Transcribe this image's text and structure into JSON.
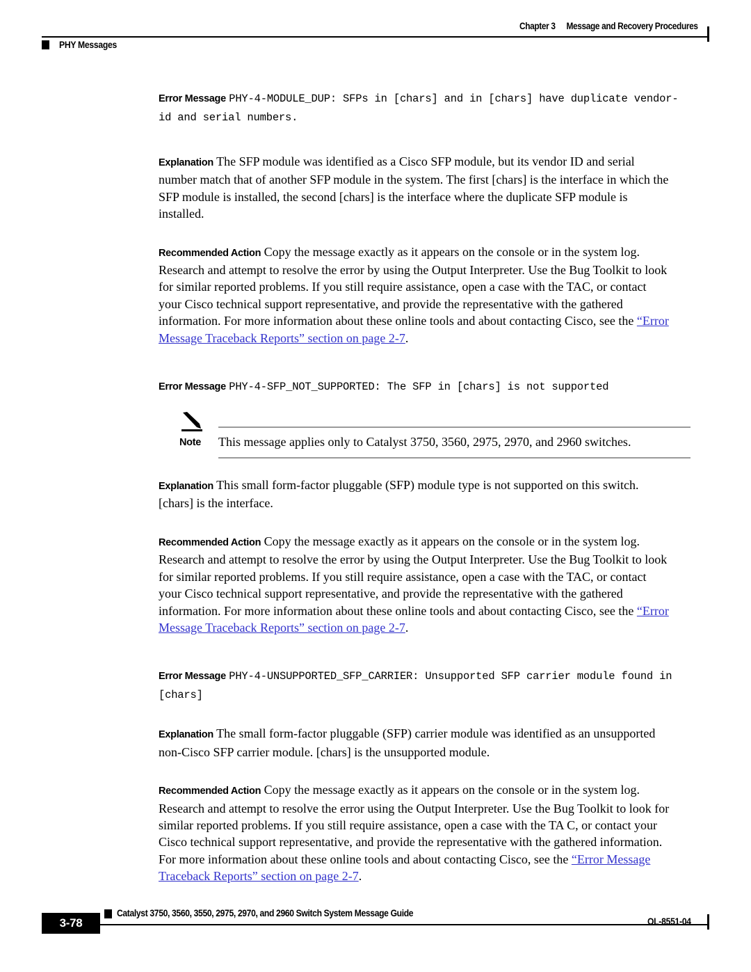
{
  "header": {
    "chapter_number": "Chapter 3",
    "chapter_title": "Message and Recovery Procedures",
    "section": "PHY Messages"
  },
  "labels": {
    "error_message": "Error Message",
    "explanation": "Explanation",
    "recommended_action": "Recommended Action",
    "note": "Note"
  },
  "link_color": "#3333cc",
  "messages": [
    {
      "id": "PHY-4-MODULE_DUP",
      "error_text": "PHY-4-MODULE_DUP: SFPs in [chars] and in [chars] have duplicate vendor-id and serial numbers.",
      "explanation": "The SFP module was identified as a Cisco SFP module, but its vendor ID and serial number match that of another SFP module in the system. The first [chars] is the interface in which the SFP module is installed, the second [chars] is the interface where the duplicate SFP module is installed.",
      "action_text": "Copy the message exactly as it appears on the console or in the system log. Research and attempt to resolve the error by using the Output Interpreter. Use the Bug Toolkit to look for similar reported problems. If you still require assistance, open a case with the TAC, or contact your Cisco technical support representative, and provide the representative with the gathered information. For more information about these online tools and about contacting Cisco, see the ",
      "action_link": "“Error Message Traceback Reports” section on page 2-7",
      "action_tail": "."
    },
    {
      "id": "PHY-4-SFP_NOT_SUPPORTED",
      "error_text": "PHY-4-SFP_NOT_SUPPORTED: The SFP in [chars] is not supported",
      "note": "This message applies only to Catalyst 3750, 3560, 2975, 2970, and 2960 switches.",
      "explanation": "This small form-factor pluggable (SFP) module type is not supported on this switch. [chars] is the interface.",
      "action_text": "Copy the message exactly as it appears on the console or in the system log. Research and attempt to resolve the error by using the Output Interpreter. Use the Bug Toolkit to look for similar reported problems. If you still require assistance, open a case with the TAC, or contact your Cisco technical support representative, and provide the representative with the gathered information. For more information about these online tools and about contacting Cisco, see the ",
      "action_link": "“Error Message Traceback Reports” section on page 2-7",
      "action_tail": "."
    },
    {
      "id": "PHY-4-UNSUPPORTED_SFP_CARRIER",
      "error_text": "PHY-4-UNSUPPORTED_SFP_CARRIER: Unsupported SFP carrier module found in [chars]",
      "explanation": "The small form-factor pluggable (SFP) carrier module was identified as an unsupported non-Cisco SFP carrier module. [chars] is the unsupported module.",
      "action_text": "Copy the message exactly as it appears on the console or in the system log. Research and attempt to resolve the error using the Output Interpreter. Use the Bug Toolkit to look for similar reported problems. If you still require assistance, open a case with the TA C, or contact your Cisco technical support representative, and provide the representative with the gathered information. For more information about these online tools and about contacting Cisco, see the ",
      "action_link": "“Error Message Traceback Reports” section on page 2-7",
      "action_tail": "."
    }
  ],
  "footer": {
    "page_number": "3-78",
    "guide_title": "Catalyst 3750, 3560, 3550, 2975, 2970, and 2960 Switch System Message Guide",
    "doc_id": "OL-8551-04"
  }
}
